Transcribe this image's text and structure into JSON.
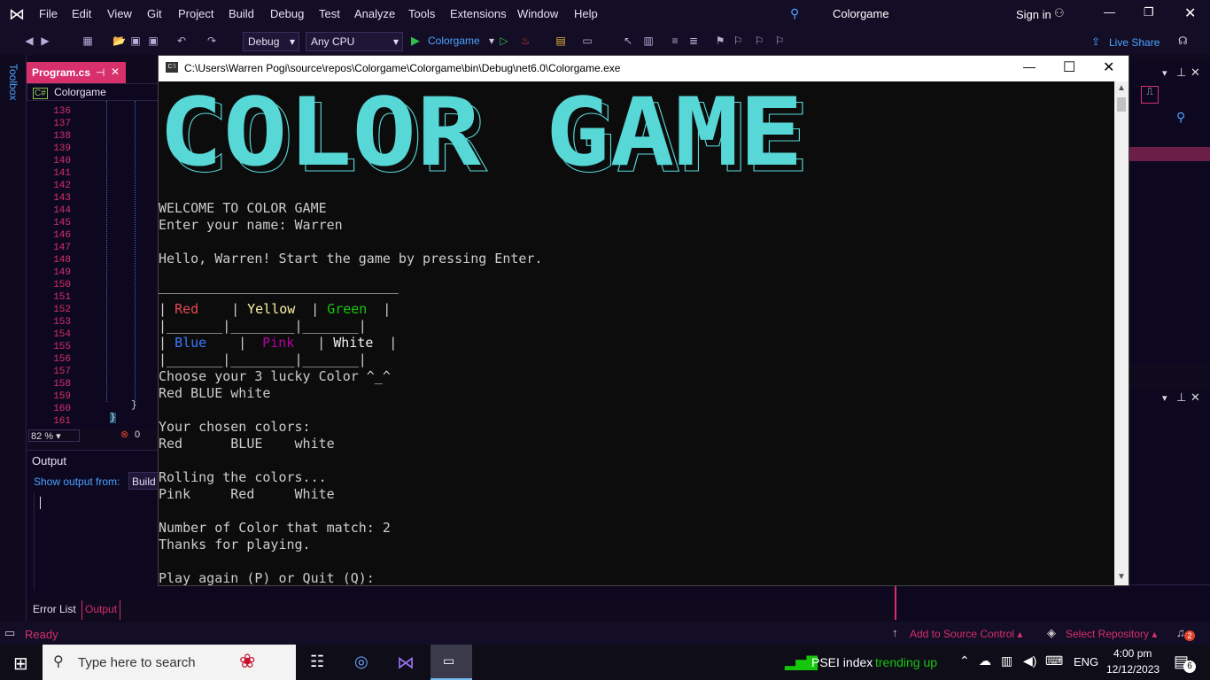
{
  "vs": {
    "menu": [
      "File",
      "Edit",
      "View",
      "Git",
      "Project",
      "Build",
      "Debug",
      "Test",
      "Analyze",
      "Tools",
      "Extensions",
      "Window",
      "Help"
    ],
    "solution_title": "Colorgame",
    "sign_in": "Sign in",
    "config": "Debug",
    "platform": "Any CPU",
    "run_target": "Colorgame",
    "live_share": "Live Share",
    "toolbox_label": "Toolbox",
    "editor_tab": "Program.cs",
    "editor_context": "Colorgame",
    "line_numbers": [
      "136",
      "137",
      "138",
      "139",
      "140",
      "141",
      "142",
      "143",
      "144",
      "145",
      "146",
      "147",
      "148",
      "149",
      "150",
      "151",
      "152",
      "153",
      "154",
      "155",
      "156",
      "157",
      "158",
      "159",
      "160",
      "161"
    ],
    "zoom": "82 %",
    "errors": "0",
    "output_title": "Output",
    "show_output_from": "Show output from:",
    "output_source": "Build",
    "bottom_tabs": [
      "Error List",
      "Output"
    ],
    "status_ready": "Ready",
    "add_source_control": "Add to Source Control",
    "select_repository": "Select Repository",
    "notifications": "2",
    "accent": "#d7306b"
  },
  "console": {
    "title": "C:\\Users\\Warren Pogi\\source\\repos\\Colorgame\\Colorgame\\bin\\Debug\\net6.0\\Colorgame.exe",
    "banner": "COLOR GAME",
    "welcome": "WELCOME TO COLOR GAME",
    "name_prompt": "Enter your name: Warren",
    "hello": "Hello, Warren! Start the game by pressing Enter.",
    "table_top": "______________________________",
    "colors": [
      {
        "label": "Red",
        "color": "#e74856"
      },
      {
        "label": "Yellow",
        "color": "#f9f1a5"
      },
      {
        "label": "Green",
        "color": "#16c60c"
      },
      {
        "label": "Blue",
        "color": "#3b78ff"
      },
      {
        "label": "Pink",
        "color": "#b4009e"
      },
      {
        "label": "White",
        "color": "#f2f2f2"
      }
    ],
    "choose": "Choose your 3 lucky Color ^_^",
    "input": "Red BLUE white",
    "chosen_label": "Your chosen colors:",
    "chosen": "Red      BLUE    white",
    "rolling": "Rolling the colors...",
    "rolled": "Pink     Red     White",
    "match": "Number of Color that match: 2",
    "thanks": "Thanks for playing.",
    "again": "Play again (P) or Quit (Q):",
    "banner_color": "#58d7d7"
  },
  "taskbar": {
    "search_placeholder": "Type here to search",
    "stock_name": "PSEI index",
    "stock_trend": "trending up",
    "lang": "ENG",
    "time": "4:00 pm",
    "date": "12/12/2023",
    "notif_count": "6"
  }
}
